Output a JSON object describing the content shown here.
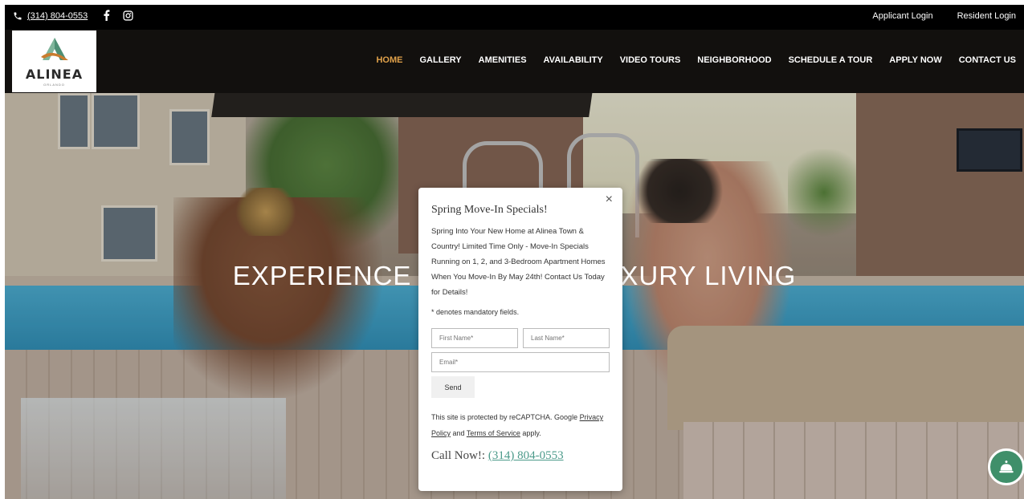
{
  "topbar": {
    "phone": "(314) 804-0553",
    "applicant_login": "Applicant Login",
    "resident_login": "Resident Login"
  },
  "logo": {
    "name": "ALINEA",
    "tagline": "ORLANDO"
  },
  "nav": {
    "items": [
      "HOME",
      "GALLERY",
      "AMENITIES",
      "AVAILABILITY",
      "VIDEO TOURS",
      "NEIGHBORHOOD",
      "SCHEDULE A TOUR",
      "APPLY NOW",
      "CONTACT US"
    ],
    "active": "HOME"
  },
  "hero": {
    "title_left": "EXPERIENCE",
    "title_right": "XURY LIVING"
  },
  "modal": {
    "title": "Spring Move-In Specials!",
    "body": "Spring Into Your New Home at Alinea Town & Country! Limited Time Only - Move-In Specials Running on 1, 2, and 3-Bedroom Apartment Homes When You Move-In By May 24th! Contact Us Today for Details!",
    "mandatory_note": "* denotes mandatory fields.",
    "first_name_placeholder": "First Name*",
    "last_name_placeholder": "Last Name*",
    "email_placeholder": "Email*",
    "send_label": "Send",
    "captcha_text": "This site is protected by reCAPTCHA. Google",
    "privacy_link": "Privacy Policy",
    "and_text": " and ",
    "terms_link": "Terms of Service",
    "apply_text": " apply.",
    "call_label": "Call Now!:",
    "call_phone": "(314) 804-0553",
    "close_symbol": "×"
  },
  "colors": {
    "nav_active": "#e0a14a",
    "link_teal": "#4b9a8a",
    "bubble_green": "#3f8f6a"
  }
}
